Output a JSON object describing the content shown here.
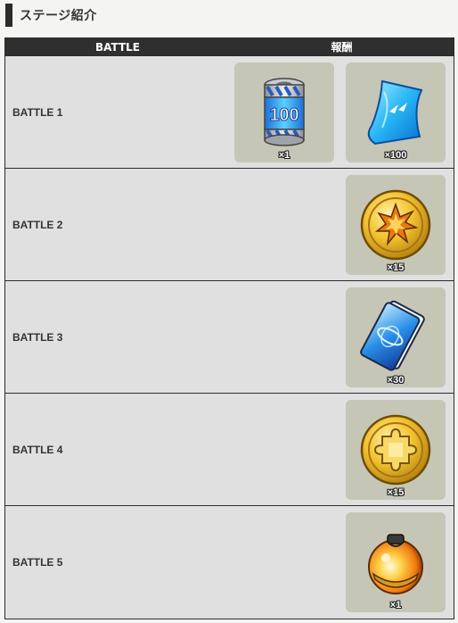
{
  "section": {
    "title": "ステージ紹介"
  },
  "table": {
    "headers": {
      "battle": "BATTLE",
      "reward": "報酬"
    },
    "rows": [
      {
        "label": "BATTLE 1",
        "rewards": [
          {
            "icon": "energy-canister-icon",
            "qty": "×1",
            "canister_text": "100"
          },
          {
            "icon": "blue-ticket-icon",
            "qty": "×100"
          }
        ]
      },
      {
        "label": "BATTLE 2",
        "rewards": [
          {
            "icon": "gold-burst-medal-icon",
            "qty": "×15"
          }
        ]
      },
      {
        "label": "BATTLE 3",
        "rewards": [
          {
            "icon": "blue-card-icon",
            "qty": "×30"
          }
        ]
      },
      {
        "label": "BATTLE 4",
        "rewards": [
          {
            "icon": "gold-puzzle-medal-icon",
            "qty": "×15"
          }
        ]
      },
      {
        "label": "BATTLE 5",
        "rewards": [
          {
            "icon": "orange-orb-icon",
            "qty": "×1"
          }
        ]
      }
    ]
  },
  "colors": {
    "header_bg": "#2f2f2f",
    "row_bg": "#e0e0e0",
    "tile_bg": "#c6c6b6",
    "gold": "#e8b42a",
    "blue": "#2f8fe8"
  }
}
